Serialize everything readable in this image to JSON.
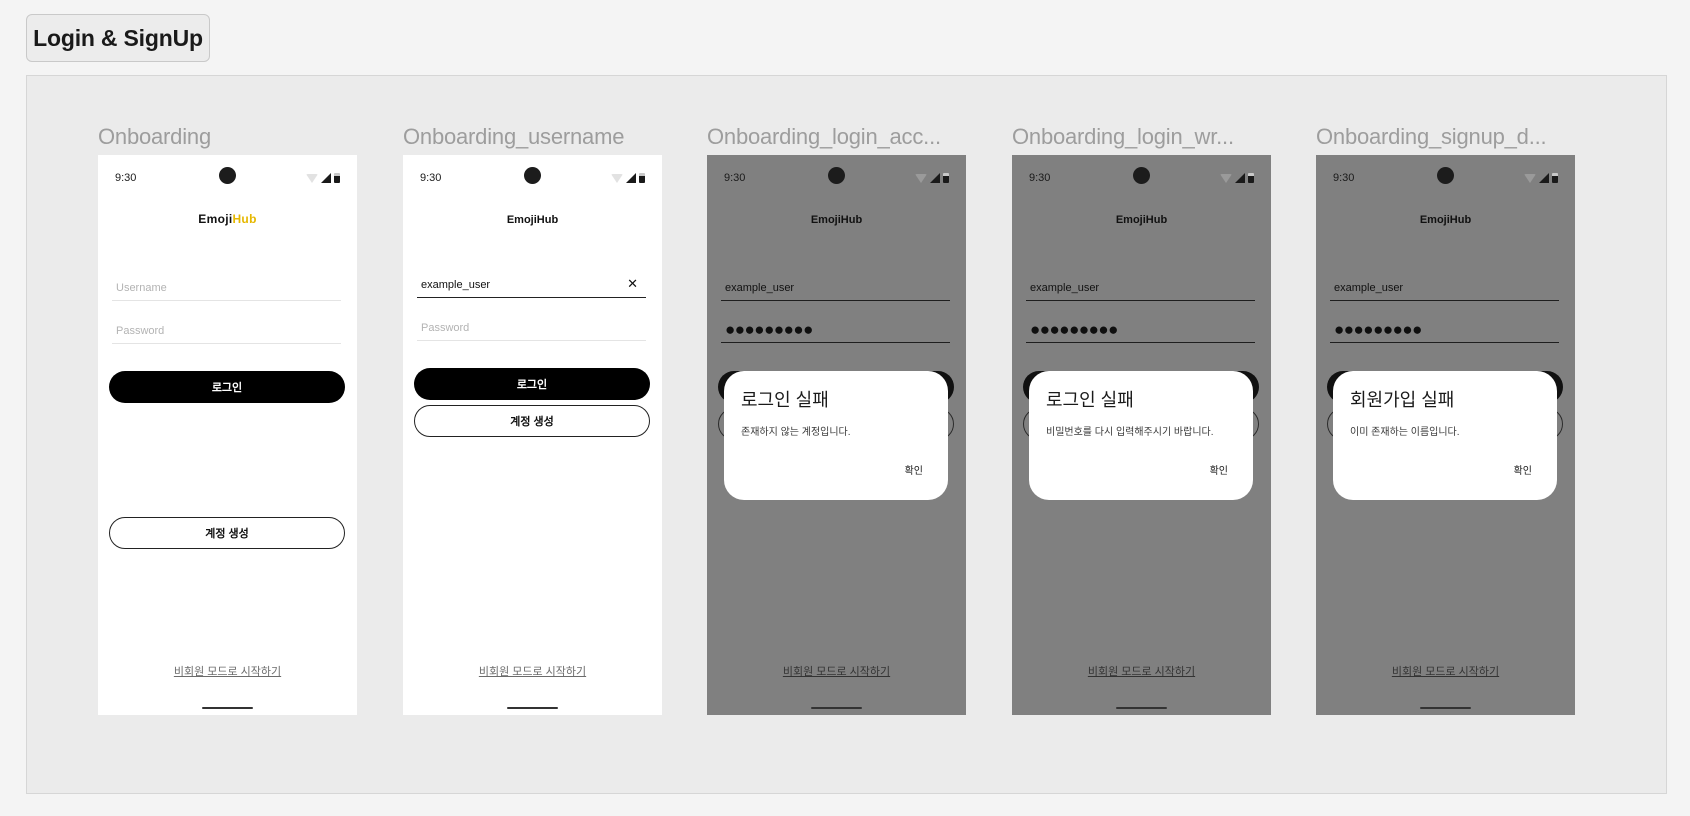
{
  "section": {
    "title": "Login & SignUp"
  },
  "frames": [
    {
      "title": "Onboarding",
      "time": "9:30",
      "logo_main": "Emoji",
      "logo_accent": "Hub",
      "username_placeholder": "Username",
      "password_placeholder": "Password",
      "login_label": "로그인",
      "signup_label": "계정 생성",
      "guest_label": "비회원 모드로 시작하기"
    },
    {
      "title": "Onboarding_username",
      "time": "9:30",
      "logo": "EmojiHub",
      "username_value": "example_user",
      "clear_icon": "✕",
      "password_placeholder": "Password",
      "login_label": "로그인",
      "signup_label": "계정 생성",
      "guest_label": "비회원 모드로 시작하기"
    },
    {
      "title": "Onboarding_login_acc...",
      "time": "9:30",
      "logo": "EmojiHub",
      "username_value": "example_user",
      "password_value": "●●●●●●●●●",
      "guest_label": "비회원 모드로 시작하기",
      "dialog_title": "로그인 실패",
      "dialog_message": "존재하지 않는 계정입니다.",
      "dialog_ok": "확인"
    },
    {
      "title": "Onboarding_login_wr...",
      "time": "9:30",
      "logo": "EmojiHub",
      "username_value": "example_user",
      "password_value": "●●●●●●●●●",
      "guest_label": "비회원 모드로 시작하기",
      "dialog_title": "로그인 실패",
      "dialog_message": "비밀번호를 다시 입력해주시기 바랍니다.",
      "dialog_ok": "확인"
    },
    {
      "title": "Onboarding_signup_d...",
      "time": "9:30",
      "logo": "EmojiHub",
      "username_value": "example_user",
      "password_value": "●●●●●●●●●",
      "guest_label": "비회원 모드로 시작하기",
      "dialog_title": "회원가입 실패",
      "dialog_message": "이미 존재하는 이름입니다.",
      "dialog_ok": "확인"
    }
  ],
  "colors": {
    "accent": "#e6b800",
    "dim_overlay": "#808080",
    "primary": "#000000"
  }
}
